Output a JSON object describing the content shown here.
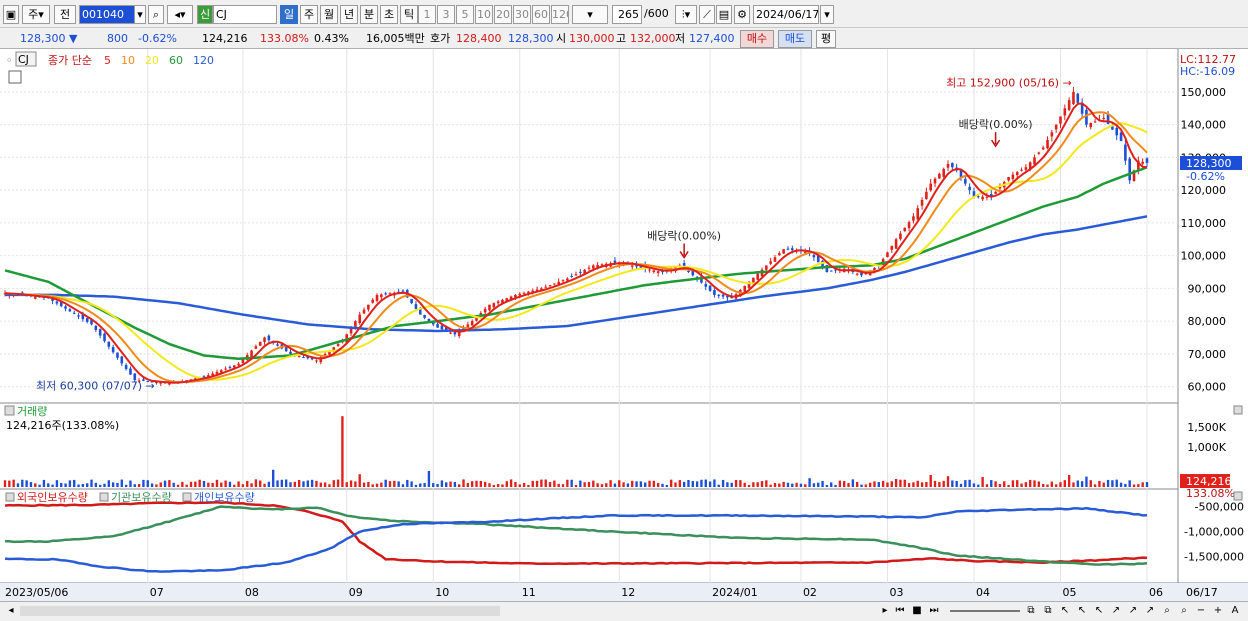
{
  "toolbar": {
    "type_select": "주",
    "prefix": "전",
    "code": "001040",
    "shin": "신",
    "name": "CJ",
    "periods": [
      "일",
      "주",
      "월",
      "년",
      "분",
      "초",
      "틱"
    ],
    "intervals": [
      "1",
      "3",
      "5",
      "10",
      "20",
      "30",
      "60",
      "120"
    ],
    "count": "265",
    "count_total": "/600",
    "date": "2024/06/17"
  },
  "quote": {
    "price": "128,300",
    "arrow": "▼",
    "change": "800",
    "change_pct": "-0.62%",
    "volume": "124,216",
    "vol_ratio": "133.08%",
    "turnover": "0.43%",
    "amount": "16,005백만",
    "hoga_label": "호가",
    "ask": "128,400",
    "bid": "128,300",
    "open_label": "시",
    "open": "130,000",
    "high_label": "고",
    "high": "132,000",
    "low_label": "저",
    "low": "127,400",
    "buy": "매수",
    "sell": "매도",
    "extra": "평"
  },
  "colors": {
    "up": "#e0201a",
    "down": "#1c4fd6",
    "ma5": "#e0201a",
    "ma10": "#f08a1c",
    "ma20": "#f2e81c",
    "ma60": "#1f9a36",
    "ma120": "#2a5bd7",
    "foreign": "#d11a1a",
    "inst": "#3a8f5a",
    "indiv": "#2a5bd7"
  },
  "chart_data": [
    {
      "type": "candlestick",
      "title": "CJ",
      "legend": {
        "label": "종가 단순",
        "periods": [
          "5",
          "10",
          "20",
          "60",
          "120"
        ]
      },
      "ylim": [
        55000,
        157000
      ],
      "yticks": [
        "60,000",
        "70,000",
        "80,000",
        "90,000",
        "100,000",
        "110,000",
        "120,000",
        "130,000",
        "140,000",
        "150,000"
      ],
      "ytick_values": [
        60000,
        70000,
        80000,
        90000,
        100000,
        110000,
        120000,
        130000,
        140000,
        150000
      ],
      "current_price_label": "128,300",
      "current_pct_label": "-0.62%",
      "lc_label": "LC:112.77",
      "hc_label": "HC:-16.09",
      "annotations": {
        "high": "최고 152,900 (05/16)",
        "low": "최저 60,300 (07/07)",
        "div1": "배당락(0.00%)",
        "div2": "배당락(0.00%)"
      },
      "close_anchors": [
        [
          0,
          88500
        ],
        [
          10,
          87000
        ],
        [
          20,
          79000
        ],
        [
          30,
          62000
        ],
        [
          38,
          61000
        ],
        [
          46,
          63000
        ],
        [
          54,
          67000
        ],
        [
          60,
          75000
        ],
        [
          66,
          70000
        ],
        [
          72,
          68000
        ],
        [
          78,
          74000
        ],
        [
          82,
          82000
        ],
        [
          86,
          88000
        ],
        [
          92,
          89000
        ],
        [
          96,
          82000
        ],
        [
          100,
          78000
        ],
        [
          104,
          76000
        ],
        [
          108,
          80000
        ],
        [
          112,
          85000
        ],
        [
          118,
          88000
        ],
        [
          124,
          90000
        ],
        [
          130,
          93000
        ],
        [
          136,
          97000
        ],
        [
          142,
          98000
        ],
        [
          148,
          96000
        ],
        [
          152,
          95000
        ],
        [
          156,
          97000
        ],
        [
          160,
          93000
        ],
        [
          164,
          88000
        ],
        [
          168,
          87000
        ],
        [
          172,
          92000
        ],
        [
          176,
          97000
        ],
        [
          180,
          102000
        ],
        [
          186,
          101000
        ],
        [
          190,
          95000
        ],
        [
          194,
          96000
        ],
        [
          198,
          94000
        ],
        [
          202,
          97000
        ],
        [
          206,
          105000
        ],
        [
          210,
          112000
        ],
        [
          214,
          122000
        ],
        [
          218,
          128000
        ],
        [
          220,
          126000
        ],
        [
          224,
          118000
        ],
        [
          228,
          118000
        ],
        [
          232,
          124000
        ],
        [
          236,
          127000
        ],
        [
          240,
          133000
        ],
        [
          243,
          140000
        ],
        [
          247,
          150000
        ],
        [
          250,
          140000
        ],
        [
          254,
          142000
        ],
        [
          258,
          135000
        ],
        [
          260,
          123000
        ],
        [
          262,
          129000
        ],
        [
          264,
          128300
        ]
      ],
      "ma60_anchors": [
        [
          0,
          95500
        ],
        [
          10,
          92000
        ],
        [
          20,
          85000
        ],
        [
          30,
          78000
        ],
        [
          38,
          73000
        ],
        [
          46,
          69500
        ],
        [
          54,
          68500
        ],
        [
          66,
          69500
        ],
        [
          78,
          74000
        ],
        [
          90,
          78500
        ],
        [
          100,
          80000
        ],
        [
          112,
          82000
        ],
        [
          124,
          85000
        ],
        [
          136,
          88000
        ],
        [
          148,
          91000
        ],
        [
          160,
          93000
        ],
        [
          170,
          94500
        ],
        [
          180,
          95500
        ],
        [
          190,
          96500
        ],
        [
          200,
          97000
        ],
        [
          208,
          99000
        ],
        [
          214,
          102000
        ],
        [
          220,
          105000
        ],
        [
          226,
          108000
        ],
        [
          232,
          111000
        ],
        [
          240,
          115000
        ],
        [
          248,
          118000
        ],
        [
          254,
          122000
        ],
        [
          260,
          125000
        ],
        [
          264,
          127000
        ]
      ],
      "ma120_anchors": [
        [
          0,
          88000
        ],
        [
          12,
          88000
        ],
        [
          25,
          87500
        ],
        [
          40,
          85500
        ],
        [
          55,
          82000
        ],
        [
          70,
          79000
        ],
        [
          85,
          77500
        ],
        [
          100,
          77000
        ],
        [
          115,
          77500
        ],
        [
          130,
          78500
        ],
        [
          145,
          81500
        ],
        [
          160,
          84500
        ],
        [
          175,
          87500
        ],
        [
          190,
          90000
        ],
        [
          200,
          92500
        ],
        [
          208,
          95000
        ],
        [
          216,
          98000
        ],
        [
          224,
          101000
        ],
        [
          232,
          104000
        ],
        [
          240,
          106500
        ],
        [
          248,
          108000
        ],
        [
          256,
          110000
        ],
        [
          264,
          112000
        ]
      ],
      "high_marker": {
        "index": 248,
        "value": 152900
      },
      "low_marker": {
        "index": 36,
        "value": 60300
      },
      "div_markers": [
        {
          "index": 157,
          "value": 97000
        },
        {
          "index": 229,
          "value": 131000
        }
      ]
    },
    {
      "type": "bar",
      "title": "거래량",
      "info": "124,216주(133.08%)",
      "ylim": [
        0,
        1850000
      ],
      "yticks": [
        "1,000K",
        "1,500K"
      ],
      "ytick_values": [
        1000000,
        1500000
      ],
      "last_label": "124,216",
      "last_pct": "133.08%",
      "base_volume": 120000,
      "spikes": [
        [
          78,
          1770000
        ],
        [
          62,
          430000
        ],
        [
          98,
          400000
        ],
        [
          64,
          180000
        ],
        [
          56,
          150000
        ],
        [
          82,
          320000
        ],
        [
          214,
          300000
        ],
        [
          218,
          270000
        ],
        [
          226,
          250000
        ],
        [
          246,
          300000
        ],
        [
          250,
          260000
        ],
        [
          186,
          220000
        ],
        [
          206,
          200000
        ]
      ]
    },
    {
      "type": "line",
      "legend": [
        "외국인보유수량",
        "기관보유수량",
        "개인보유수량"
      ],
      "ylim": [
        -1950000,
        -350000
      ],
      "yticks": [
        "-500,000",
        "-1,000,000",
        "-1,500,000"
      ],
      "ytick_values": [
        -500000,
        -1000000,
        -1500000
      ],
      "series": [
        {
          "name": "외국인보유수량",
          "anchors": [
            [
              0,
              -480000
            ],
            [
              20,
              -470000
            ],
            [
              35,
              -430000
            ],
            [
              50,
              -420000
            ],
            [
              62,
              -480000
            ],
            [
              70,
              -600000
            ],
            [
              78,
              -800000
            ],
            [
              82,
              -1200000
            ],
            [
              88,
              -1550000
            ],
            [
              100,
              -1600000
            ],
            [
              120,
              -1640000
            ],
            [
              140,
              -1640000
            ],
            [
              170,
              -1630000
            ],
            [
              200,
              -1620000
            ],
            [
              214,
              -1540000
            ],
            [
              224,
              -1590000
            ],
            [
              240,
              -1620000
            ],
            [
              256,
              -1560000
            ],
            [
              264,
              -1520000
            ]
          ]
        },
        {
          "name": "기관보유수량",
          "anchors": [
            [
              0,
              -1200000
            ],
            [
              10,
              -1200000
            ],
            [
              25,
              -1100000
            ],
            [
              40,
              -750000
            ],
            [
              50,
              -500000
            ],
            [
              62,
              -560000
            ],
            [
              72,
              -520000
            ],
            [
              80,
              -700000
            ],
            [
              90,
              -790000
            ],
            [
              110,
              -850000
            ],
            [
              140,
              -1000000
            ],
            [
              170,
              -1130000
            ],
            [
              200,
              -1160000
            ],
            [
              210,
              -1300000
            ],
            [
              220,
              -1480000
            ],
            [
              240,
              -1600000
            ],
            [
              252,
              -1660000
            ],
            [
              264,
              -1640000
            ]
          ]
        },
        {
          "name": "개인보유수량",
          "anchors": [
            [
              0,
              -1550000
            ],
            [
              12,
              -1560000
            ],
            [
              22,
              -1700000
            ],
            [
              34,
              -1800000
            ],
            [
              50,
              -1780000
            ],
            [
              65,
              -1620000
            ],
            [
              75,
              -1350000
            ],
            [
              82,
              -1000000
            ],
            [
              92,
              -850000
            ],
            [
              110,
              -810000
            ],
            [
              140,
              -680000
            ],
            [
              170,
              -680000
            ],
            [
              200,
              -700000
            ],
            [
              212,
              -720000
            ],
            [
              220,
              -600000
            ],
            [
              235,
              -560000
            ],
            [
              250,
              -540000
            ],
            [
              264,
              -680000
            ]
          ]
        }
      ]
    }
  ],
  "xaxis": {
    "labels": [
      "2023/05/06",
      "07",
      "08",
      "09",
      "10",
      "11",
      "12",
      "2024/01",
      "02",
      "03",
      "04",
      "05",
      "06",
      "06/17"
    ],
    "label_index": [
      0,
      33,
      55,
      79,
      99,
      119,
      142,
      163,
      184,
      204,
      224,
      244,
      264
    ]
  }
}
